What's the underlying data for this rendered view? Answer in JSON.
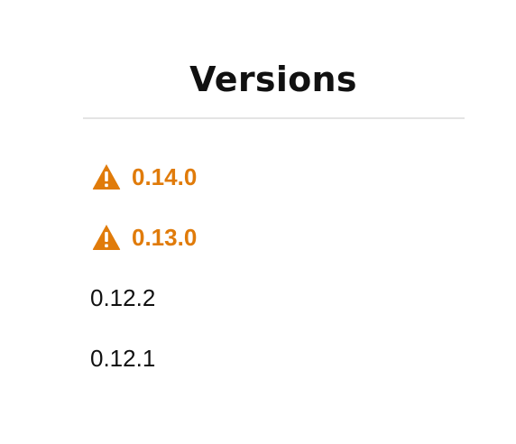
{
  "header": {
    "title": "Versions"
  },
  "colors": {
    "warning": "#e07b0a",
    "text": "#111111",
    "divider": "#e4e4e4"
  },
  "versions": [
    {
      "label": "0.14.0",
      "warning": true,
      "icon": "warning-triangle-icon"
    },
    {
      "label": "0.13.0",
      "warning": true,
      "icon": "warning-triangle-icon"
    },
    {
      "label": "0.12.2",
      "warning": false
    },
    {
      "label": "0.12.1",
      "warning": false
    }
  ]
}
